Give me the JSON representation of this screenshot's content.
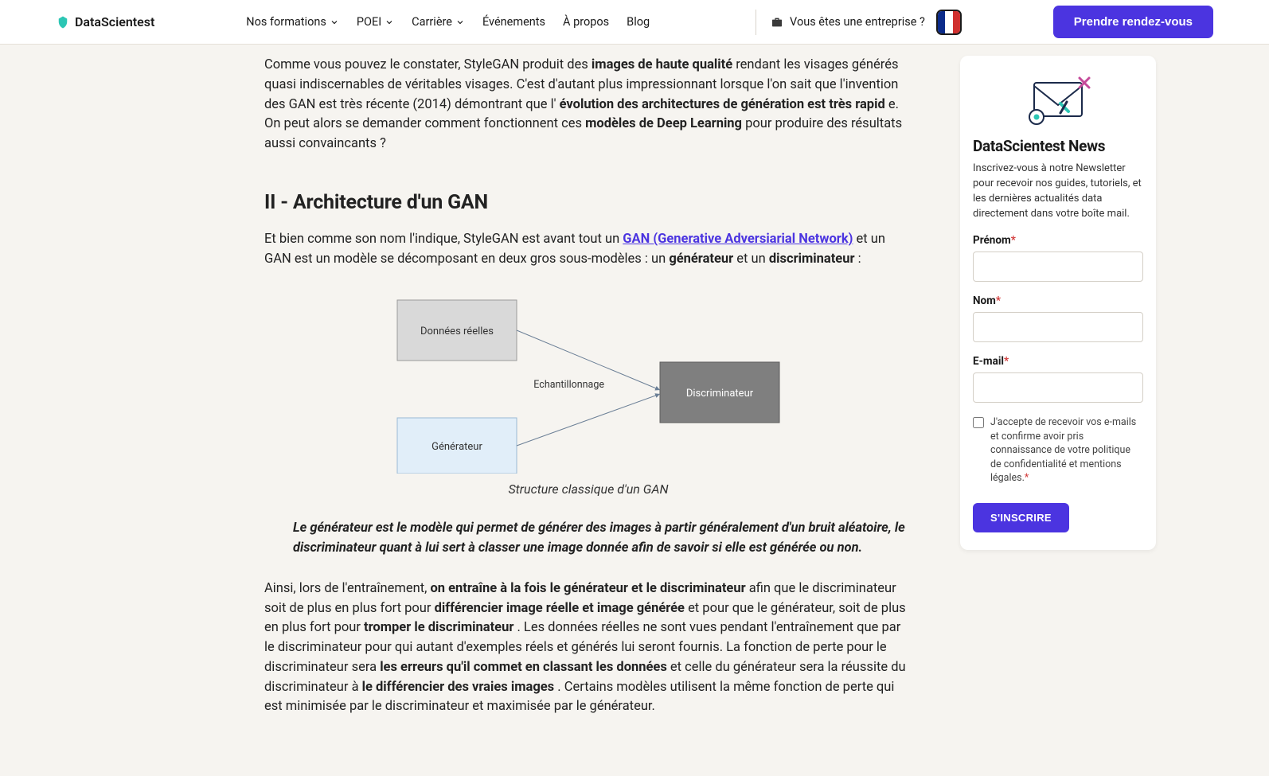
{
  "brand": "DataScientest",
  "nav": {
    "formations": "Nos formations",
    "poei": "POEI",
    "carriere": "Carrière",
    "evenements": "Événements",
    "apropos": "À propos",
    "blog": "Blog"
  },
  "enterprise": "Vous êtes une entreprise ?",
  "cta": "Prendre rendez-vous",
  "article": {
    "p1_a": "Comme vous pouvez le constater, StyleGAN produit des ",
    "p1_b": "images de haute qualité",
    "p1_c": " rendant les visages générés quasi indiscernables de véritables visages. C'est d'autant plus impressionnant lorsque l'on sait que l'invention des GAN est très récente (2014) démontrant que l'",
    "p1_d": "évolution des architectures de génération est très rapid",
    "p1_e": "e. On peut alors se demander comment fonctionnent ces ",
    "p1_f": "modèles de Deep Learning",
    "p1_g": " pour produire des résultats aussi convaincants ?",
    "h2": "II - Architecture d'un GAN",
    "p2_a": "Et bien comme son nom l'indique, StyleGAN est avant tout un ",
    "p2_link": "GAN (Generative Adversiarial Network)",
    "p2_b": " et un GAN est un modèle se décomposant en deux gros sous-modèles : un ",
    "p2_c": "générateur",
    "p2_d": " et un ",
    "p2_e": "discriminateur",
    "p2_f": " :",
    "diagram": {
      "node_real": "Données réelles",
      "node_gen": "Générateur",
      "node_disc": "Discriminateur",
      "edge_label": "Echantillonnage"
    },
    "caption": "Structure classique d'un GAN",
    "quote": "Le générateur est le modèle qui permet de générer des images à partir généralement d'un bruit aléatoire, le discriminateur quant à lui sert à classer une image donnée afin de savoir si elle est générée ou non.",
    "p3_a": "Ainsi, lors de l'entraînement, ",
    "p3_b": "on entraîne à la fois le générateur et le discriminateur",
    "p3_c": " afin que le discriminateur soit de plus en plus fort pour ",
    "p3_d": "différencier image réelle et image générée",
    "p3_e": " et pour que le générateur, soit de plus en plus fort pour ",
    "p3_f": "tromper le discriminateur",
    "p3_g": ". Les données réelles ne sont vues pendant l'entraînement que par le discriminateur pour qui autant d'exemples réels et générés lui seront fournis. La fonction de perte pour le discriminateur sera ",
    "p3_h": "les erreurs qu'il commet en classant les données",
    "p3_i": " et celle du générateur sera la réussite du discriminateur à ",
    "p3_j": "le différencier des vraies images",
    "p3_k": ". Certains modèles utilisent la même fonction de perte qui est minimisée par le discriminateur et maximisée par le générateur."
  },
  "sidebar": {
    "title": "DataScientest News",
    "desc": "Inscrivez-vous à notre Newsletter pour recevoir nos guides, tutoriels, et les dernières actualités data directement dans votre boîte mail.",
    "firstname": "Prénom",
    "lastname": "Nom",
    "email": "E-mail",
    "consent": "J'accepte de recevoir vos e-mails et confirme avoir pris connaissance de votre politique de confidentialité et mentions légales.",
    "submit": "S'INSCRIRE"
  }
}
